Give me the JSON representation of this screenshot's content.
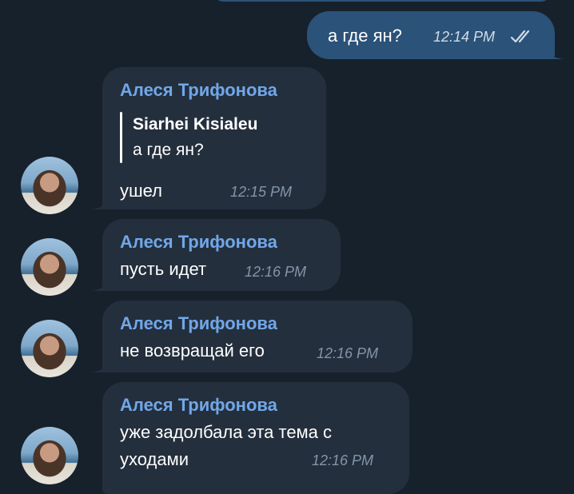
{
  "outgoing": {
    "text": "а где ян?",
    "time": "12:14 PM",
    "status_icon": "double-check-icon"
  },
  "incoming": [
    {
      "sender": "Алеся Трифонова",
      "reply": {
        "author": "Siarhei Kisialeu",
        "text": "а где ян?"
      },
      "text": "ушел",
      "time": "12:15 PM"
    },
    {
      "sender": "Алеся Трифонова",
      "text": "пусть идет",
      "time": "12:16 PM"
    },
    {
      "sender": "Алеся Трифонова",
      "text": "не возвращай его",
      "time": "12:16 PM"
    },
    {
      "sender": "Алеся Трифонова",
      "text_line1": "уже задолбала эта тема с",
      "text_line2": "уходами",
      "time": "12:16 PM"
    }
  ],
  "colors": {
    "background": "#17212b",
    "outgoing_bubble": "#2b5278",
    "incoming_bubble": "#242f3d",
    "sender_name": "#71a7e8"
  }
}
